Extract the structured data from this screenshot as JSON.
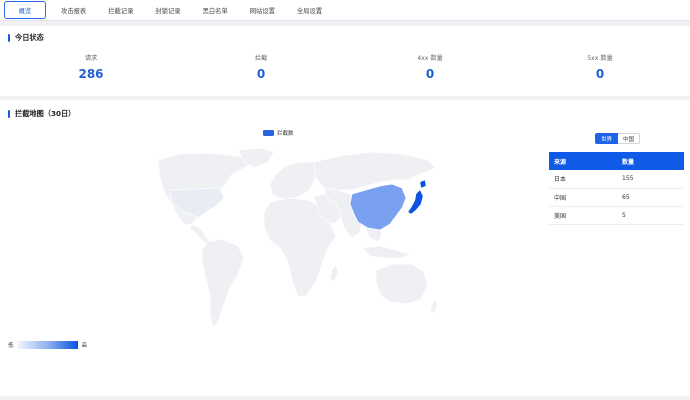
{
  "nav": {
    "tabs": [
      {
        "label": "概览",
        "active": true
      },
      {
        "label": "攻击报表",
        "active": false
      },
      {
        "label": "拦截记录",
        "active": false
      },
      {
        "label": "封锁记录",
        "active": false
      },
      {
        "label": "黑白名单",
        "active": false
      },
      {
        "label": "网站设置",
        "active": false
      },
      {
        "label": "全局设置",
        "active": false
      }
    ]
  },
  "today": {
    "title": "今日状态",
    "stats": [
      {
        "label": "请求",
        "value": "286"
      },
      {
        "label": "拦截",
        "value": "0"
      },
      {
        "label": "4xx 数量",
        "value": "0"
      },
      {
        "label": "5xx 数量",
        "value": "0"
      }
    ]
  },
  "map_section": {
    "title": "拦截地图（30日）",
    "legend_label": "拦截数",
    "toggle": {
      "on": "世界",
      "off": "中国"
    },
    "table": {
      "headers": [
        "来源",
        "数量"
      ],
      "rows": [
        {
          "source": "日本",
          "count": "155"
        },
        {
          "source": "中国",
          "count": "65"
        },
        {
          "source": "美国",
          "count": "5"
        }
      ]
    },
    "scale": {
      "low": "低",
      "high": "高"
    },
    "colors": {
      "base": "#f0f1f5",
      "china": "#7aa1f0",
      "japan": "#0a52df",
      "usa": "#eaedf6"
    }
  }
}
